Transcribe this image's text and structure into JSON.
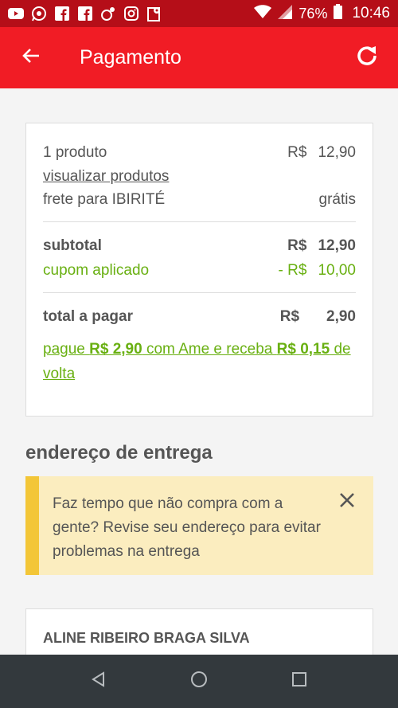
{
  "status_bar": {
    "icons": [
      "youtube-icon",
      "whatsapp-icon",
      "facebook-icon",
      "facebook-icon",
      "pinterest-icon",
      "instagram-icon",
      "maps-icon"
    ],
    "battery": "76%",
    "time": "10:46"
  },
  "app_bar": {
    "title": "Pagamento"
  },
  "summary": {
    "product_count": "1 produto",
    "product_price": "12,90",
    "view_products": "visualizar produtos",
    "shipping_label": "frete para IBIRITÉ",
    "shipping_value": "grátis",
    "subtotal_label": "subtotal",
    "subtotal_value": "12,90",
    "coupon_label": "cupom aplicado",
    "coupon_currency": "- R$",
    "coupon_value": "10,00",
    "total_label": "total a pagar",
    "total_value": "2,90",
    "currency": "R$",
    "ame_text_1": "pague ",
    "ame_amount": "R$ 2,90",
    "ame_text_2": " com Ame e receba ",
    "ame_cashback": "R$ 0,15",
    "ame_text_3": " de volta"
  },
  "delivery": {
    "section_title": "endereço de entrega",
    "warning_text": "Faz tempo que não compra com a gente? Revise seu endereço para evitar problemas na entrega",
    "recipient_name": "ALINE RIBEIRO BRAGA SILVA"
  },
  "colors": {
    "app_bar": "#f11c25",
    "status_bar": "#b50e18",
    "accent_green": "#69b012",
    "warning_bg": "#fbedbf",
    "warning_border": "#f3c637"
  }
}
